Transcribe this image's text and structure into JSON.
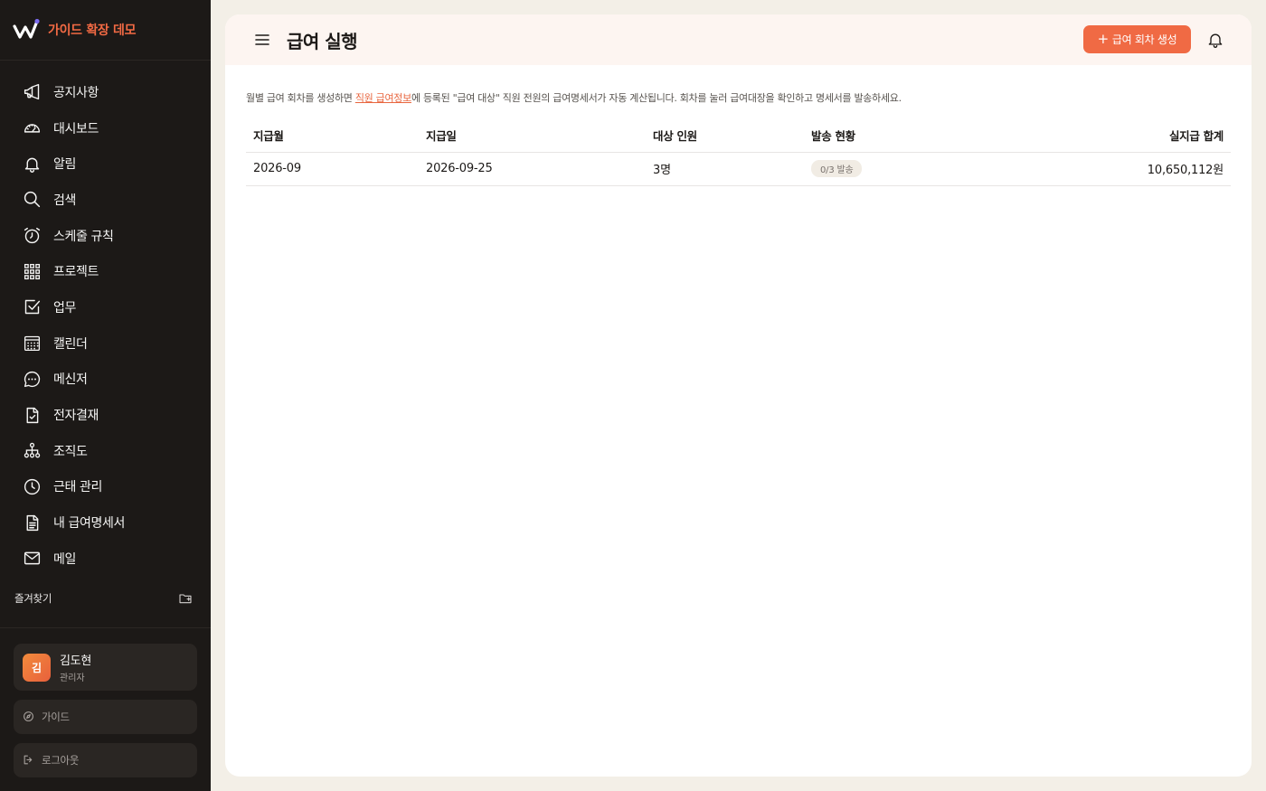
{
  "brand": {
    "name": "가이드 확장 데모",
    "logo_icon": "w-logo-icon",
    "accent": "#f26a44"
  },
  "sidebar": {
    "items": [
      {
        "label": "공지사항",
        "icon": "megaphone-icon"
      },
      {
        "label": "대시보드",
        "icon": "gauge-icon"
      },
      {
        "label": "알림",
        "icon": "bell-icon"
      },
      {
        "label": "검색",
        "icon": "search-icon"
      },
      {
        "label": "스케줄 규칙",
        "icon": "alarm-clock-icon"
      },
      {
        "label": "프로젝트",
        "icon": "grid-icon"
      },
      {
        "label": "업무",
        "icon": "checkbox-icon"
      },
      {
        "label": "캘린더",
        "icon": "calendar-icon"
      },
      {
        "label": "메신저",
        "icon": "chat-bubble-icon"
      },
      {
        "label": "전자결재",
        "icon": "document-check-icon"
      },
      {
        "label": "조직도",
        "icon": "org-chart-icon"
      },
      {
        "label": "근태 관리",
        "icon": "clock-icon"
      },
      {
        "label": "내 급여명세서",
        "icon": "document-text-icon"
      },
      {
        "label": "메일",
        "icon": "mail-icon"
      }
    ],
    "favorites_label": "즐겨찾기",
    "user": {
      "initial": "김",
      "name": "김도현",
      "role": "관리자"
    },
    "guide_label": "가이드",
    "logout_label": "로그아웃"
  },
  "header": {
    "title": "급여 실행",
    "create_button_label": "급여 회차 생성",
    "create_button_icon": "plus-icon"
  },
  "description": {
    "before_link": "월별 급여 회차를 생성하면 ",
    "link_text": "직원 급여정보",
    "after_link": "에 등록된 \"급여 대상\" 직원 전원의 급여명세서가 자동 계산됩니다. 회차를 눌러 급여대장을 확인하고 명세서를 발송하세요."
  },
  "table": {
    "columns": [
      "지급월",
      "지급일",
      "대상 인원",
      "발송 현황",
      "실지급 합계"
    ],
    "rows": [
      {
        "month": "2026-09",
        "pay_date": "2026-09-25",
        "headcount": "3명",
        "send_status": "0/3 발송",
        "net_total": "10,650,112원"
      }
    ]
  },
  "colors": {
    "sidebar_bg": "#1c1917",
    "page_bg": "#f3efe7",
    "header_bg": "#fdf5f1",
    "primary": "#f06a44",
    "badge_bg": "#f1ece4"
  }
}
